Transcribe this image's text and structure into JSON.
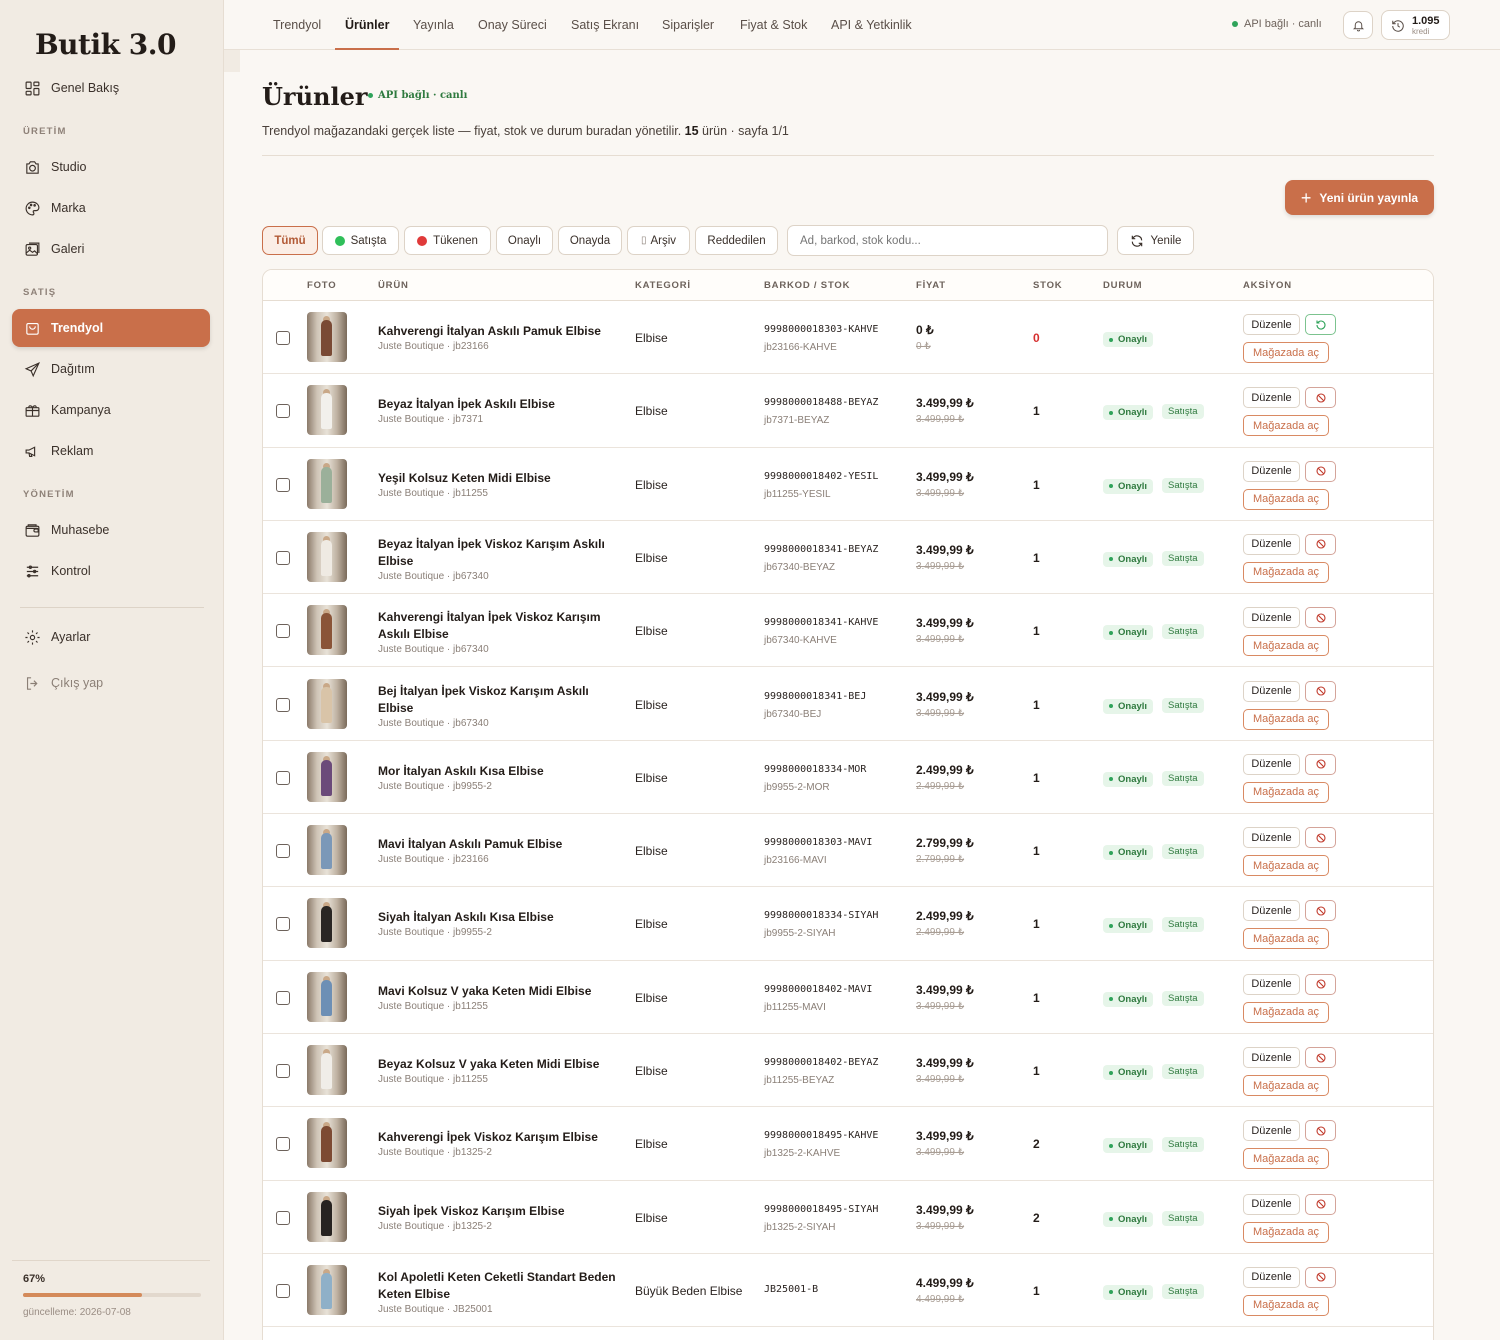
{
  "app": {
    "logo": "Butik 3.0"
  },
  "sidebar": {
    "overview": "Genel Bakış",
    "sections": {
      "production": "ÜRETİM",
      "sales": "SATIŞ",
      "management": "YÖNETİM"
    },
    "items": {
      "studio": "Studio",
      "brand": "Marka",
      "gallery": "Galeri",
      "trendyol": "Trendyol",
      "distribution": "Dağıtım",
      "campaign": "Kampanya",
      "ads": "Reklam",
      "accounting": "Muhasebe",
      "control": "Kontrol",
      "settings": "Ayarlar",
      "logout": "Çıkış yap"
    },
    "progress": {
      "label": "67%",
      "value": 0.67,
      "updated": "güncelleme: 2026-07-08"
    }
  },
  "topbar": {
    "tabs": [
      "Trendyol",
      "Ürünler",
      "Yayınla",
      "Onay Süreci",
      "Satış Ekranı",
      "Siparişler",
      "Fiyat & Stok",
      "API & Yetkinlik"
    ],
    "active_tab": "Ürünler",
    "api_status": "API bağlı · canlı",
    "credits": {
      "value": "1.095",
      "label": "kredi"
    }
  },
  "header": {
    "title": "Ürünler",
    "badge": "API bağlı · canlı",
    "subtitle_pre": "Trendyol mağazandaki gerçek liste — fiyat, stok ve durum buradan yönetilir. ",
    "count": "15",
    "subtitle_post": " ürün · sayfa 1/1",
    "new_button": "Yeni ürün yayınla"
  },
  "filters": {
    "chips": [
      "Tümü",
      "Satışta",
      "Tükenen",
      "Onaylı",
      "Onayda",
      "Arşiv",
      "Reddedilen"
    ],
    "active": "Tümü",
    "search_placeholder": "Ad, barkod, stok kodu...",
    "refresh": "Yenile"
  },
  "table": {
    "columns": [
      "FOTO",
      "ÜRÜN",
      "KATEGORİ",
      "BARKOD / STOK",
      "FİYAT",
      "STOK",
      "DURUM",
      "AKSİYON"
    ],
    "actions": {
      "edit": "Düzenle",
      "open_store": "Mağazada aç"
    },
    "rows": [
      {
        "name": "Kahverengi İtalyan Askılı Pamuk Elbise",
        "meta": "Juste Boutique · jb23166",
        "category": "Elbise",
        "barcode": "9998000018303-KAHVE",
        "sku": "jb23166-KAHVE",
        "price": "0 ₺",
        "old_price": "0 ₺",
        "stock": "0",
        "status": "Onaylı",
        "sale": "",
        "dress": "#7a4a35"
      },
      {
        "name": "Beyaz İtalyan İpek Askılı Elbise",
        "meta": "Juste Boutique · jb7371",
        "category": "Elbise",
        "barcode": "9998000018488-BEYAZ",
        "sku": "jb7371-BEYAZ",
        "price": "3.499,99 ₺",
        "old_price": "3.499,99 ₺",
        "stock": "1",
        "status": "Onaylı",
        "sale": "Satışta",
        "dress": "#f2f0ec"
      },
      {
        "name": "Yeşil Kolsuz Keten Midi Elbise",
        "meta": "Juste Boutique · jb11255",
        "category": "Elbise",
        "barcode": "9998000018402-YESIL",
        "sku": "jb11255-YESIL",
        "price": "3.499,99 ₺",
        "old_price": "3.499,99 ₺",
        "stock": "1",
        "status": "Onaylı",
        "sale": "Satışta",
        "dress": "#9bb09a"
      },
      {
        "name": "Beyaz İtalyan İpek Viskoz Karışım Askılı Elbise",
        "meta": "Juste Boutique · jb67340",
        "category": "Elbise",
        "barcode": "9998000018341-BEYAZ",
        "sku": "jb67340-BEYAZ",
        "price": "3.499,99 ₺",
        "old_price": "3.499,99 ₺",
        "stock": "1",
        "status": "Onaylı",
        "sale": "Satışta",
        "dress": "#efeae3"
      },
      {
        "name": "Kahverengi İtalyan İpek Viskoz Karışım Askılı Elbise",
        "meta": "Juste Boutique · jb67340",
        "category": "Elbise",
        "barcode": "9998000018341-KAHVE",
        "sku": "jb67340-KAHVE",
        "price": "3.499,99 ₺",
        "old_price": "3.499,99 ₺",
        "stock": "1",
        "status": "Onaylı",
        "sale": "Satışta",
        "dress": "#8a5438"
      },
      {
        "name": "Bej İtalyan İpek Viskoz Karışım Askılı Elbise",
        "meta": "Juste Boutique · jb67340",
        "category": "Elbise",
        "barcode": "9998000018341-BEJ",
        "sku": "jb67340-BEJ",
        "price": "3.499,99 ₺",
        "old_price": "3.499,99 ₺",
        "stock": "1",
        "status": "Onaylı",
        "sale": "Satışta",
        "dress": "#d9c4a8"
      },
      {
        "name": "Mor İtalyan Askılı Kısa Elbise",
        "meta": "Juste Boutique · jb9955-2",
        "category": "Elbise",
        "barcode": "9998000018334-MOR",
        "sku": "jb9955-2-MOR",
        "price": "2.499,99 ₺",
        "old_price": "2.499,99 ₺",
        "stock": "1",
        "status": "Onaylı",
        "sale": "Satışta",
        "dress": "#6b4a7a"
      },
      {
        "name": "Mavi İtalyan Askılı Pamuk Elbise",
        "meta": "Juste Boutique · jb23166",
        "category": "Elbise",
        "barcode": "9998000018303-MAVI",
        "sku": "jb23166-MAVI",
        "price": "2.799,99 ₺",
        "old_price": "2.799,99 ₺",
        "stock": "1",
        "status": "Onaylı",
        "sale": "Satışta",
        "dress": "#7b98b8"
      },
      {
        "name": "Siyah İtalyan Askılı Kısa Elbise",
        "meta": "Juste Boutique · jb9955-2",
        "category": "Elbise",
        "barcode": "9998000018334-SIYAH",
        "sku": "jb9955-2-SIYAH",
        "price": "2.499,99 ₺",
        "old_price": "2.499,99 ₺",
        "stock": "1",
        "status": "Onaylı",
        "sale": "Satışta",
        "dress": "#2a2624"
      },
      {
        "name": "Mavi Kolsuz V yaka Keten Midi Elbise",
        "meta": "Juste Boutique · jb11255",
        "category": "Elbise",
        "barcode": "9998000018402-MAVI",
        "sku": "jb11255-MAVI",
        "price": "3.499,99 ₺",
        "old_price": "3.499,99 ₺",
        "stock": "1",
        "status": "Onaylı",
        "sale": "Satışta",
        "dress": "#6d8fb5"
      },
      {
        "name": "Beyaz Kolsuz V yaka Keten Midi Elbise",
        "meta": "Juste Boutique · jb11255",
        "category": "Elbise",
        "barcode": "9998000018402-BEYAZ",
        "sku": "jb11255-BEYAZ",
        "price": "3.499,99 ₺",
        "old_price": "3.499,99 ₺",
        "stock": "1",
        "status": "Onaylı",
        "sale": "Satışta",
        "dress": "#f0ede8"
      },
      {
        "name": "Kahverengi İpek Viskoz Karışım Elbise",
        "meta": "Juste Boutique · jb1325-2",
        "category": "Elbise",
        "barcode": "9998000018495-KAHVE",
        "sku": "jb1325-2-KAHVE",
        "price": "3.499,99 ₺",
        "old_price": "3.499,99 ₺",
        "stock": "2",
        "status": "Onaylı",
        "sale": "Satışta",
        "dress": "#7d4a33"
      },
      {
        "name": "Siyah İpek Viskoz Karışım Elbise",
        "meta": "Juste Boutique · jb1325-2",
        "category": "Elbise",
        "barcode": "9998000018495-SIYAH",
        "sku": "jb1325-2-SIYAH",
        "price": "3.499,99 ₺",
        "old_price": "3.499,99 ₺",
        "stock": "2",
        "status": "Onaylı",
        "sale": "Satışta",
        "dress": "#272321"
      },
      {
        "name": "Kol Apoletli Keten Ceketli Standart Beden Keten Elbise",
        "meta": "Juste Boutique · JB25001",
        "category": "Büyük Beden Elbise",
        "barcode": "JB25001-B",
        "sku": "",
        "price": "4.499,99 ₺",
        "old_price": "4.499,99 ₺",
        "stock": "1",
        "status": "Onaylı",
        "sale": "Satışta",
        "dress": "#8fb0c8"
      }
    ]
  },
  "colors": {
    "accent": "#c96f4a",
    "success": "#2fa35a",
    "danger": "#d62f2f"
  }
}
